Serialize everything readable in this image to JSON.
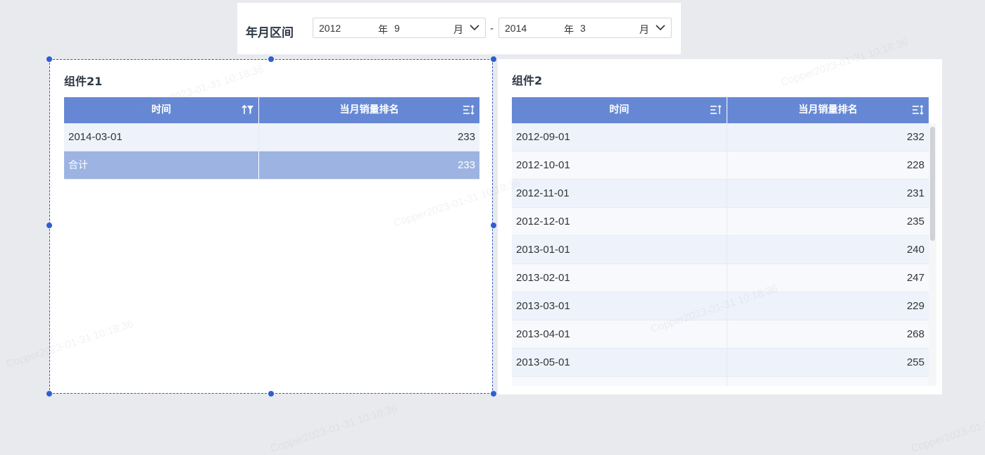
{
  "filter": {
    "label": "年月区间",
    "start": {
      "year": "2012",
      "year_unit": "年",
      "month": "9",
      "month_unit": "月"
    },
    "separator": "-",
    "end": {
      "year": "2014",
      "year_unit": "年",
      "month": "3",
      "month_unit": "月"
    }
  },
  "widget1": {
    "title": "组件21",
    "columns": [
      "时间",
      "当月销量排名"
    ],
    "rows": [
      {
        "date": "2014-03-01",
        "value": "233"
      }
    ],
    "total": {
      "label": "合计",
      "value": "233"
    }
  },
  "widget2": {
    "title": "组件2",
    "columns": [
      "时间",
      "当月销量排名"
    ],
    "rows": [
      {
        "date": "2012-09-01",
        "value": "232"
      },
      {
        "date": "2012-10-01",
        "value": "228"
      },
      {
        "date": "2012-11-01",
        "value": "231"
      },
      {
        "date": "2012-12-01",
        "value": "235"
      },
      {
        "date": "2013-01-01",
        "value": "240"
      },
      {
        "date": "2013-02-01",
        "value": "247"
      },
      {
        "date": "2013-03-01",
        "value": "229"
      },
      {
        "date": "2013-04-01",
        "value": "268"
      },
      {
        "date": "2013-05-01",
        "value": "255"
      }
    ]
  },
  "watermark": "Copper2023-01-31 10:18:36",
  "icons": {
    "sort": "sort-icon",
    "filter": "filter-icon",
    "chevron": "chevron-down-icon"
  },
  "colors": {
    "header_bg": "#6688d4",
    "total_bg": "#9db4e2",
    "selection": "#2e5fcf"
  }
}
